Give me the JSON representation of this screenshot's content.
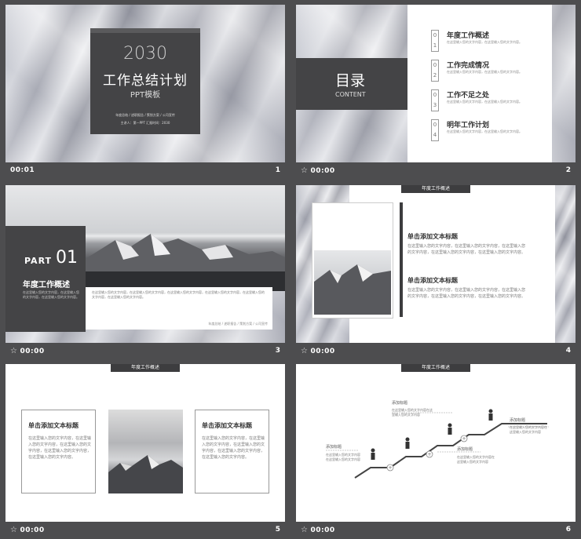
{
  "slides": [
    {
      "number": "1",
      "time": "00:01",
      "year": "2030",
      "title": "工作总结计划",
      "subtitle": "PPT模板",
      "meta1": "年度总结 / 述职报告 / 策划方案 / 公司宣传",
      "meta2": "主讲人：第一PPT  汇报时间：2030"
    },
    {
      "number": "2",
      "time": "00:00",
      "toc_title": "目录",
      "toc_en": "CONTENT",
      "items": [
        {
          "num": "0",
          "sub": "1",
          "label": "年度工作概述",
          "desc": "在这里输入您的文字内容，在这里输入您的文字内容。"
        },
        {
          "num": "0",
          "sub": "2",
          "label": "工作完成情况",
          "desc": "在这里输入您的文字内容，在这里输入您的文字内容。"
        },
        {
          "num": "0",
          "sub": "3",
          "label": "工作不足之处",
          "desc": "在这里输入您的文字内容，在这里输入您的文字内容。"
        },
        {
          "num": "0",
          "sub": "4",
          "label": "明年工作计划",
          "desc": "在这里输入您的文字内容，在这里输入您的文字内容。"
        }
      ]
    },
    {
      "number": "3",
      "time": "00:00",
      "part": "PART",
      "part_num": "01",
      "heading": "年度工作概述",
      "desc": "在这里输入您的文字内容，在这里输入您的文字内容，在这里输入您的文字内容。",
      "band": "在这里输入您的文字内容，在这里输入您的文字内容，在这里输入您的文字内容，在这里输入您的文字内容，在这里输入您的文字内容，在这里输入您的文字内容。",
      "footer": "年度总结 / 述职报告 / 策划方案 / 公司宣传"
    },
    {
      "number": "4",
      "time": "00:00",
      "tag": "年度工作概述",
      "blocks": [
        {
          "title": "单击添加文本标题",
          "body": "在这里输入您的文字内容，在这里输入您的文字内容，在这里输入您的文字内容，在这里输入您的文字内容，在这里输入您的文字内容。"
        },
        {
          "title": "单击添加文本标题",
          "body": "在这里输入您的文字内容，在这里输入您的文字内容，在这里输入您的文字内容，在这里输入您的文字内容，在这里输入您的文字内容。"
        }
      ]
    },
    {
      "number": "5",
      "time": "00:00",
      "tag": "年度工作概述",
      "blocks": [
        {
          "title": "单击添加文本标题",
          "body": "在这里输入您的文字内容，在这里输入您的文字内容，在这里输入您的文字内容，在这里输入您的文字内容，在这里输入您的文字内容。"
        },
        {
          "title": "单击添加文本标题",
          "body": "在这里输入您的文字内容，在这里输入您的文字内容，在这里输入您的文字内容，在这里输入您的文字内容，在这里输入您的文字内容。"
        }
      ]
    },
    {
      "number": "6",
      "time": "00:00",
      "tag": "年度工作概述",
      "steps": [
        {
          "label": "添加标题",
          "body": "在这里输入您的文字内容在这里输入您的文字内容"
        },
        {
          "label": "添加标题",
          "body": "在这里输入您的文字内容在这里输入您的文字内容"
        },
        {
          "label": "添加标题",
          "body": "在这里输入您的文字内容在这里输入您的文字内容"
        },
        {
          "label": "添加标题",
          "body": "在这里输入您的文字内容在这里输入您的文字内容"
        }
      ]
    }
  ]
}
